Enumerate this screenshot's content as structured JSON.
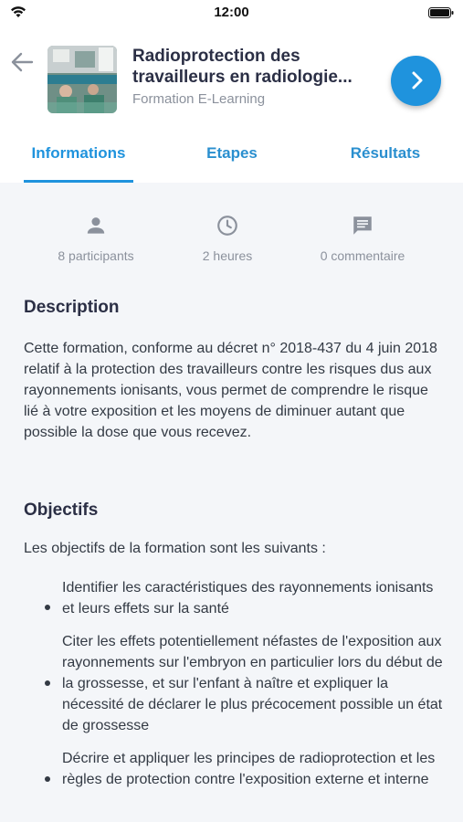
{
  "status_bar": {
    "time": "12:00"
  },
  "header": {
    "title": "Radioprotection des travailleurs en radiologie...",
    "subtitle": "Formation E-Learning"
  },
  "tabs": [
    {
      "label": "Informations"
    },
    {
      "label": "Etapes"
    },
    {
      "label": "Résultats"
    }
  ],
  "stats": {
    "participants": "8 participants",
    "duration": "2 heures",
    "comments": "0 commentaire"
  },
  "description": {
    "heading": "Description",
    "text": "Cette formation, conforme au décret n° 2018-437 du 4 juin 2018 relatif à la protection des travailleurs contre les risques dus aux rayonnements ionisants, vous permet de comprendre le risque lié à votre exposition et les moyens de diminuer autant que possible la dose que vous recevez."
  },
  "objectives": {
    "heading": "Objectifs",
    "intro": "Les objectifs de la formation sont les suivants :",
    "items": [
      "Identifier les caractéristiques des rayonnements ionisants et leurs effets sur la santé",
      "Citer les effets potentiellement néfastes de l'exposition aux rayonnements sur l'embryon en particulier lors du début de la grossesse, et sur l'enfant à naître et expliquer la nécessité de déclarer le plus précocement possible un état de grossesse",
      "Décrire et appliquer les principes de radioprotection et les règles de protection contre l'exposition externe et interne"
    ]
  },
  "colors": {
    "accent": "#1f93dd",
    "background": "#f4f6f9",
    "muted": "#8b919c",
    "heading": "#2b2f45"
  }
}
